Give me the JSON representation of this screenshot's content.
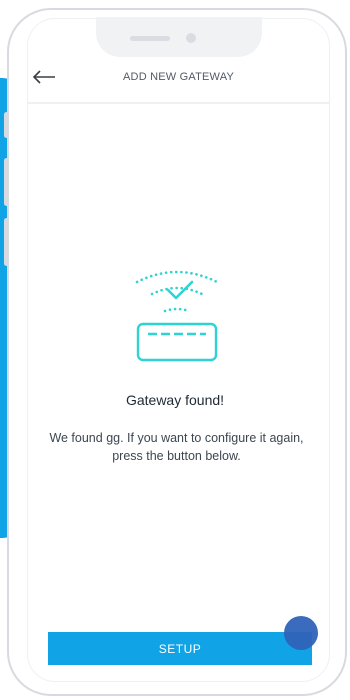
{
  "header": {
    "title": "ADD NEW GATEWAY",
    "back_icon": "arrow-left-icon"
  },
  "main": {
    "illustration_icon": "gateway-found-icon",
    "heading": "Gateway found!",
    "description": "We found gg. If you want to configure it again, press the button below."
  },
  "footer": {
    "setup_label": "SETUP"
  },
  "colors": {
    "accent": "#10a4e6",
    "icon": "#2ed3d3",
    "touch_indicator": "#2f63b8"
  }
}
